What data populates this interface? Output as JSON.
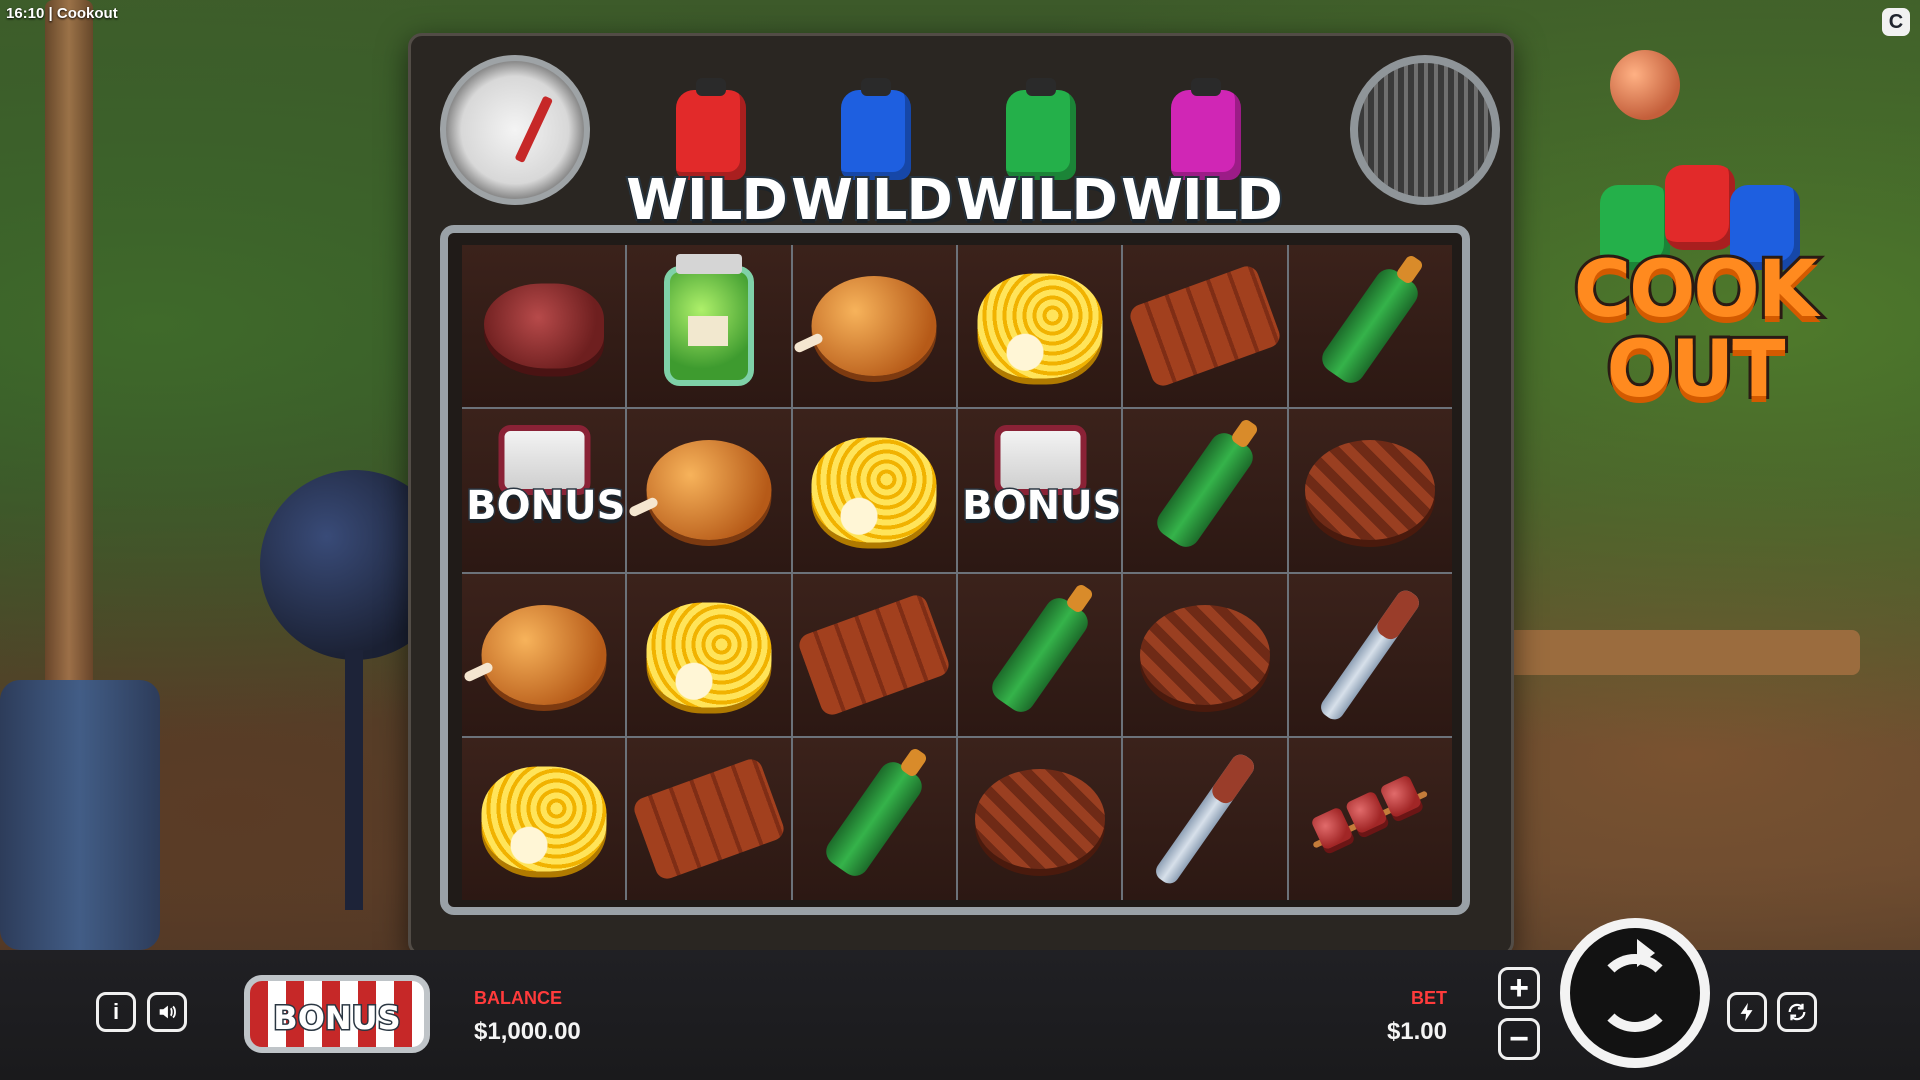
{
  "header": {
    "time_title": "16:10 | Cookout",
    "brand_badge": "C"
  },
  "logo": {
    "line1": "COOK",
    "line2": "OUT"
  },
  "wild_label": "WILD",
  "bonus_label": "BONUS",
  "wild_tanks": [
    "red",
    "blue",
    "green",
    "magenta"
  ],
  "grid": [
    [
      "steak",
      "jar",
      "chicken",
      "corn",
      "ribs",
      "bottle"
    ],
    [
      "bonus",
      "chicken",
      "corn",
      "bonus",
      "bottle",
      "patty"
    ],
    [
      "chicken",
      "corn",
      "ribs",
      "bottle",
      "patty",
      "tongs"
    ],
    [
      "corn",
      "ribs",
      "bottle",
      "patty",
      "tongs",
      "skewer"
    ]
  ],
  "footer": {
    "balance_label": "BALANCE",
    "balance_value": "$1,000.00",
    "bet_label": "BET",
    "bet_value": "$1.00",
    "bonus_buy_label": "BONUS",
    "plus_label": "+",
    "minus_label": "−",
    "info_label": "i",
    "sound_icon": "speaker-icon",
    "turbo_icon": "lightning-icon",
    "autoplay_icon": "autoplay-icon"
  },
  "colors": {
    "accent_red": "#ff3b3b",
    "frame": "#9aa1a7",
    "tank_red": "#e22a2a",
    "tank_blue": "#1e5fe0",
    "tank_green": "#24b04a",
    "tank_magenta": "#d026b5",
    "logo_orange": "#ff8a1f"
  }
}
